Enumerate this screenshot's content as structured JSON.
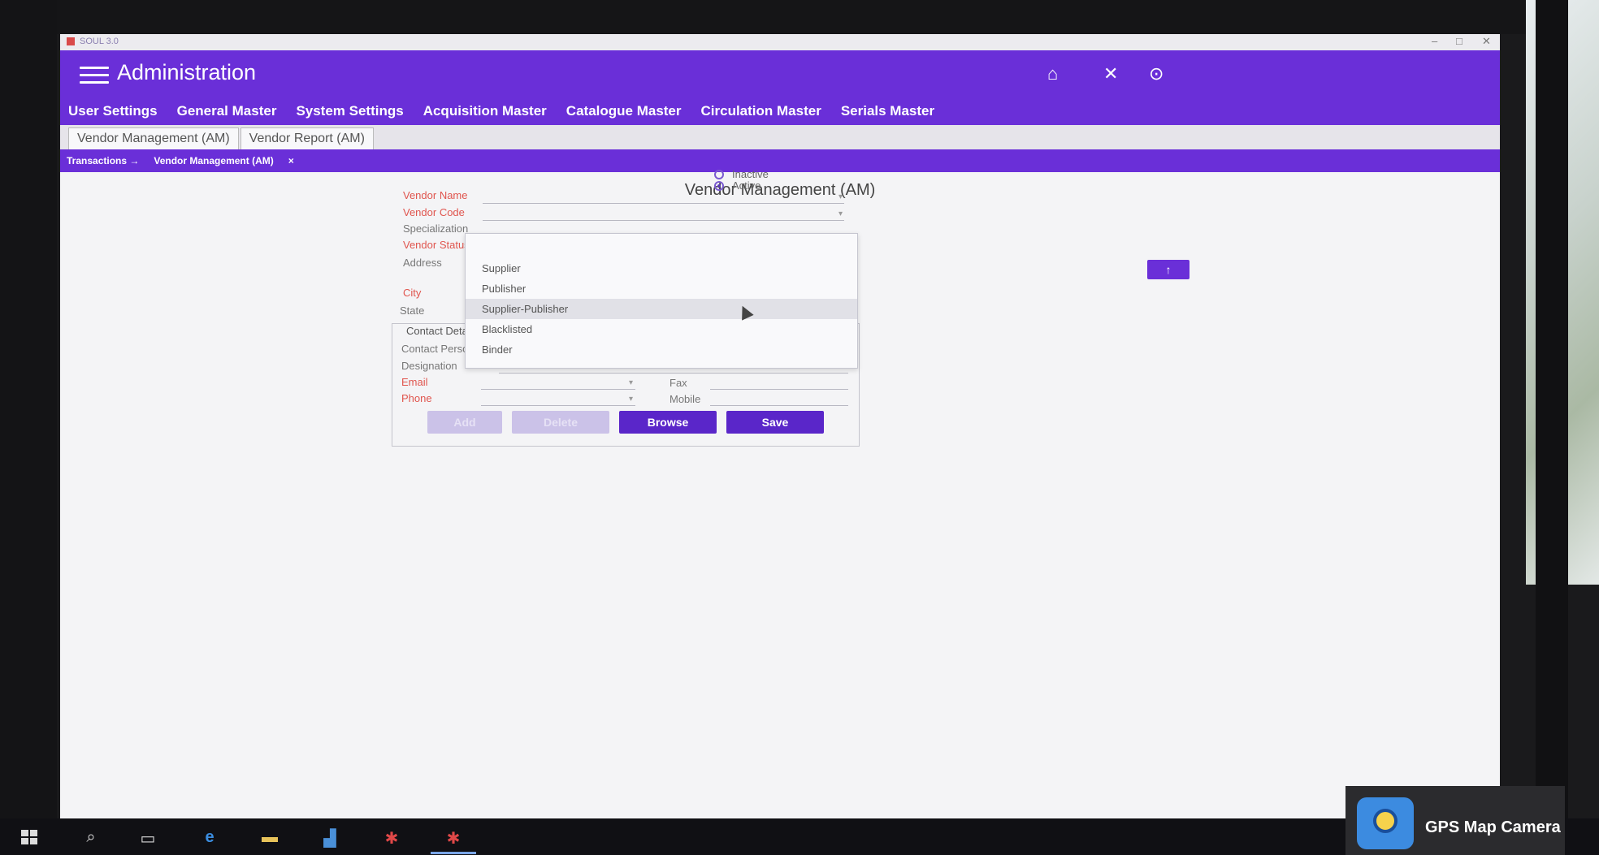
{
  "window": {
    "app_name": "SOUL 3.0",
    "title": "Administration",
    "controls": {
      "minimize": "–",
      "maximize": "□",
      "close": "✕"
    }
  },
  "appbar": {
    "icons": [
      "home-icon",
      "close-icon",
      "help-icon"
    ]
  },
  "menubar": {
    "items": [
      {
        "label": "User Settings"
      },
      {
        "label": "General Master"
      },
      {
        "label": "System Settings"
      },
      {
        "label": "Acquisition Master"
      },
      {
        "label": "Catalogue Master"
      },
      {
        "label": "Circulation Master"
      },
      {
        "label": "Serials Master"
      }
    ]
  },
  "tabs": [
    {
      "label": "Vendor Management (AM)"
    },
    {
      "label": "Vendor Report (AM)"
    }
  ],
  "breadcrumb": {
    "root": "Transactions →",
    "current": "Vendor Management (AM)",
    "close": "×"
  },
  "form": {
    "title": "Vendor Management (AM)",
    "status_options": [
      {
        "label": "Inactive",
        "checked": false
      },
      {
        "label": "Active",
        "checked": true
      }
    ],
    "labels": {
      "vendor_name": "Vendor Name",
      "vendor_code": "Vendor Code",
      "specialization": "Specialization",
      "vendor_status": "Vendor Status",
      "address": "Address",
      "city": "City",
      "state": "State",
      "contact_details": "Contact Details",
      "contact_person": "Contact Person",
      "designation": "Designation",
      "email": "Email",
      "phone": "Phone",
      "fax": "Fax",
      "mobile": "Mobile"
    },
    "vendor_status_dropdown": {
      "options": [
        "Supplier",
        "Publisher",
        "Supplier-Publisher",
        "Blacklisted",
        "Binder"
      ],
      "hovered": "Supplier-Publisher"
    }
  },
  "buttons": {
    "add": "Add",
    "delete": "Delete",
    "browse": "Browse",
    "save": "Save",
    "side": "↑"
  },
  "watermark": {
    "text": "GPS Map Camera"
  },
  "colors": {
    "accent": "#6a2fd8",
    "required_label": "#e0554e",
    "disabled_button": "#cbc2e8"
  }
}
